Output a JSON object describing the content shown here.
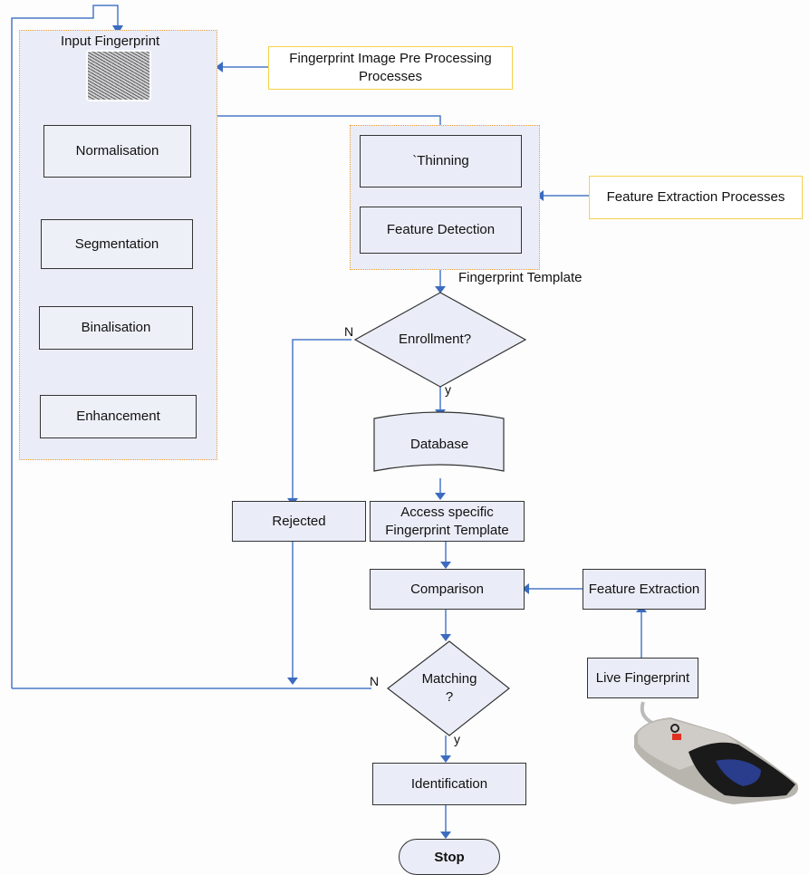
{
  "diagram": {
    "preprocessing_group": {
      "title": "Input Fingerprint",
      "steps": [
        "Normalisation",
        "Segmentation",
        "Binalisation",
        "Enhancement"
      ]
    },
    "preprocessing_note": "Fingerprint Image Pre Processing Processes",
    "feature_group": {
      "steps": [
        "`Thinning",
        "Feature Detection"
      ]
    },
    "feature_note": "Feature Extraction Processes",
    "template_label": "Fingerprint Template",
    "enrollment_decision": "Enrollment?",
    "enrollment_no": "N",
    "enrollment_yes": "y",
    "database": "Database",
    "rejected": "Rejected",
    "access_template": "Access specific Fingerprint Template",
    "comparison": "Comparison",
    "feature_extraction": "Feature Extraction",
    "live_fingerprint": "Live Fingerprint",
    "matching_decision": "Matching ?",
    "matching_no": "N",
    "matching_yes": "y",
    "identification": "Identification",
    "stop": "Stop",
    "colors": {
      "connector": "#4a7ac8",
      "box_fill": "#eaedf7",
      "group_border": "#f0a030",
      "note_border": "#f5d24a"
    }
  }
}
